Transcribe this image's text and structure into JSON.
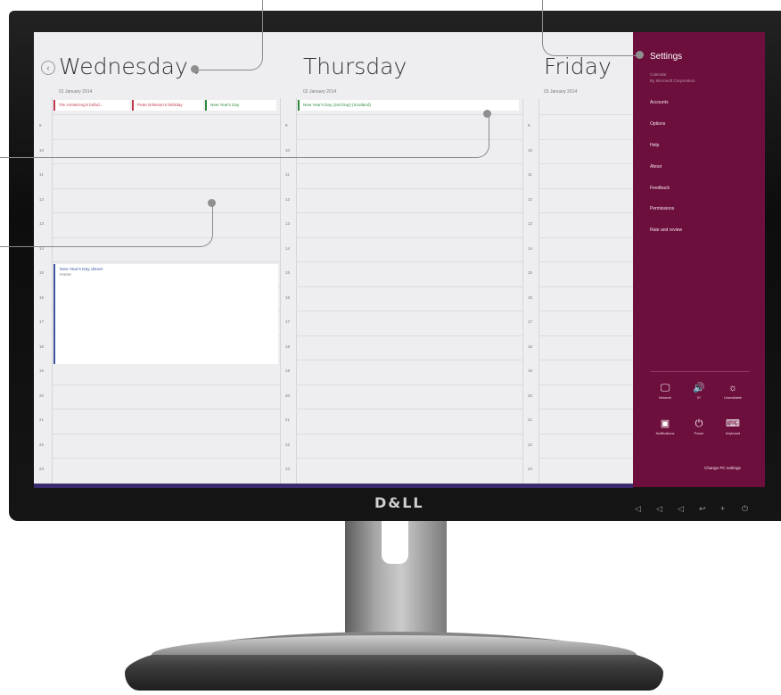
{
  "monitor": {
    "brand": "D&LL"
  },
  "calendar": {
    "days": [
      {
        "name": "Wednesday",
        "date": "01 January 2014"
      },
      {
        "name": "Thursday",
        "date": "02 January 2014"
      },
      {
        "name": "Friday",
        "date": "03 January 2014"
      }
    ],
    "hours": [
      "9",
      "10",
      "11",
      "12",
      "13",
      "14",
      "15",
      "16",
      "17",
      "18",
      "19",
      "20",
      "21",
      "22",
      "23"
    ],
    "all_day_events": [
      {
        "label": "Tim Armstrong's birthd...",
        "color": "#c0394b"
      },
      {
        "label": "Peter Eriksson's birthday",
        "color": "#c0394b"
      },
      {
        "label": "New Year's Day",
        "color": "#2e8b3e"
      },
      {
        "label": "New Year's Day (2nd Day) (Scotland)",
        "color": "#2e8b3e"
      }
    ],
    "event": {
      "title": "New Year's Day dinner",
      "location": "Home",
      "color": "#3b55a0"
    }
  },
  "settings_charm": {
    "title": "Settings",
    "app_name": "Calendar",
    "publisher": "By Microsoft Corporation",
    "items": [
      "Accounts",
      "Options",
      "Help",
      "About",
      "Feedback",
      "Permissions",
      "Rate and review"
    ],
    "quick_settings": [
      {
        "icon": "network-icon",
        "glyph": "🖵",
        "label": "Network"
      },
      {
        "icon": "volume-icon",
        "glyph": "🔊",
        "label": "57"
      },
      {
        "icon": "brightness-icon",
        "glyph": "☼",
        "label": "Unavailable"
      },
      {
        "icon": "notifications-icon",
        "glyph": "▣",
        "label": "Notifications"
      },
      {
        "icon": "power-icon",
        "glyph": "⏻",
        "label": "Power"
      },
      {
        "icon": "keyboard-icon",
        "glyph": "⌨",
        "label": "Keyboard"
      }
    ],
    "change_pc_settings": "Change PC settings",
    "background": "#6d0f3c"
  }
}
